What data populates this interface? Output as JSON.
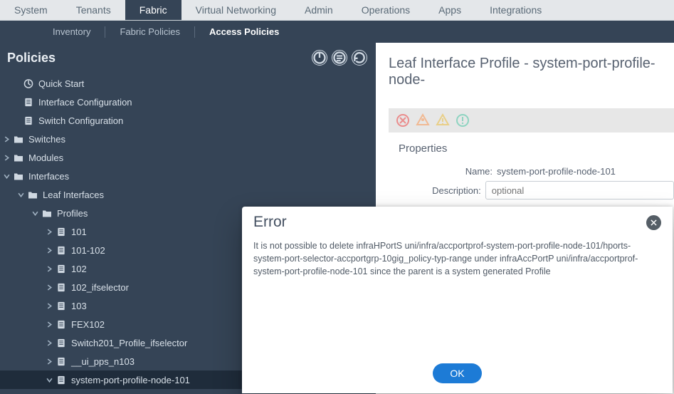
{
  "topnav": {
    "items": [
      "System",
      "Tenants",
      "Fabric",
      "Virtual Networking",
      "Admin",
      "Operations",
      "Apps",
      "Integrations"
    ],
    "active": 2
  },
  "subnav": {
    "items": [
      "Inventory",
      "Fabric Policies",
      "Access Policies"
    ],
    "active": 2
  },
  "sidebar": {
    "title": "Policies",
    "tree": {
      "quick_start": "Quick Start",
      "if_config": "Interface Configuration",
      "sw_config": "Switch Configuration",
      "switches": "Switches",
      "modules": "Modules",
      "interfaces": "Interfaces",
      "leaf_interfaces": "Leaf Interfaces",
      "profiles": "Profiles",
      "profile_items": [
        "101",
        "101-102",
        "102",
        "102_ifselector",
        "103",
        "FEX102",
        "Switch201_Profile_ifselector",
        "__ui_pps_n103",
        "system-port-profile-node-101"
      ],
      "selected_index": 8
    }
  },
  "main": {
    "title_prefix": "Leaf Interface Profile - ",
    "title_value": "system-port-profile-node-",
    "properties_heading": "Properties",
    "name_label": "Name:",
    "name_value": "system-port-profile-node-101",
    "description_label": "Description:",
    "description_placeholder": "optional"
  },
  "modal": {
    "title": "Error",
    "message": "It is not possible to delete infraHPortS uni/infra/accportprof-system-port-profile-node-101/hports-system-port-selector-accportgrp-10gig_policy-typ-range under infraAccPortP uni/infra/accportprof-system-port-profile-node-101 since the parent is a system generated Profile",
    "ok": "OK"
  }
}
